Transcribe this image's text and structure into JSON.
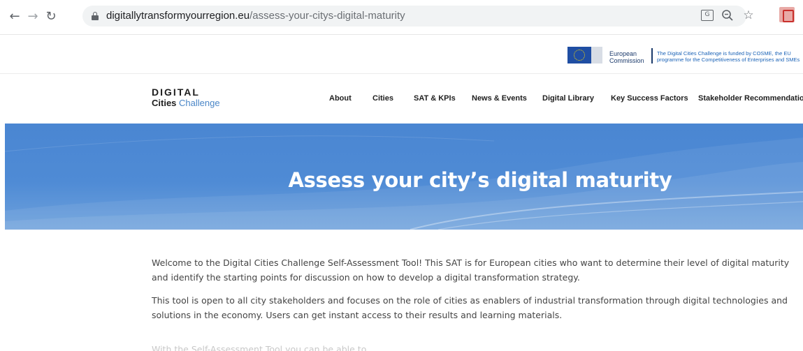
{
  "browser": {
    "url_host": "digitallytransformyourregion.eu",
    "url_path": "/assess-your-citys-digital-maturity",
    "icons": {
      "back": "back-arrow-icon",
      "forward": "forward-arrow-icon",
      "reload": "reload-icon",
      "lock": "lock-icon",
      "translate": "translate-icon",
      "zoom": "zoom-icon",
      "bookmark": "star-icon",
      "extension": "pdf-extension-icon"
    }
  },
  "eu_banner": {
    "commission_line1": "European",
    "commission_line2": "Commission",
    "funding_line1": "The Digital Cities Challenge is funded by COSME, the EU",
    "funding_line2": "programme for the Competitiveness of Enterprises and SMEs",
    "flag_color": "#1f4ea3"
  },
  "site": {
    "logo_top": "DIGITAL",
    "logo_bottom_word1": "Cities",
    "logo_bottom_word2": "Challenge",
    "menu": [
      {
        "label": "About"
      },
      {
        "label": "Cities"
      },
      {
        "label": "SAT & KPIs"
      },
      {
        "label": "News & Events"
      },
      {
        "label": "Digital Library"
      },
      {
        "label": "Key Success Factors"
      },
      {
        "label": "Stakeholder Recommendations"
      }
    ]
  },
  "hero": {
    "title": "Assess your city’s digital maturity",
    "color": "#4a86d2"
  },
  "content": {
    "paragraph1": "Welcome to the Digital Cities Challenge Self-Assessment Tool! This SAT is for European cities who want to determine their level of digital maturity and identify the starting points for discussion on how to develop a digital transformation strategy.",
    "paragraph2": "This tool is open to all city stakeholders and focuses on the role of cities as enablers of industrial transformation through digital technologies and solutions in the economy. Users can get instant access to their results and learning materials.",
    "paragraph3_partial": "With the Self-Assessment Tool you can be able to"
  }
}
